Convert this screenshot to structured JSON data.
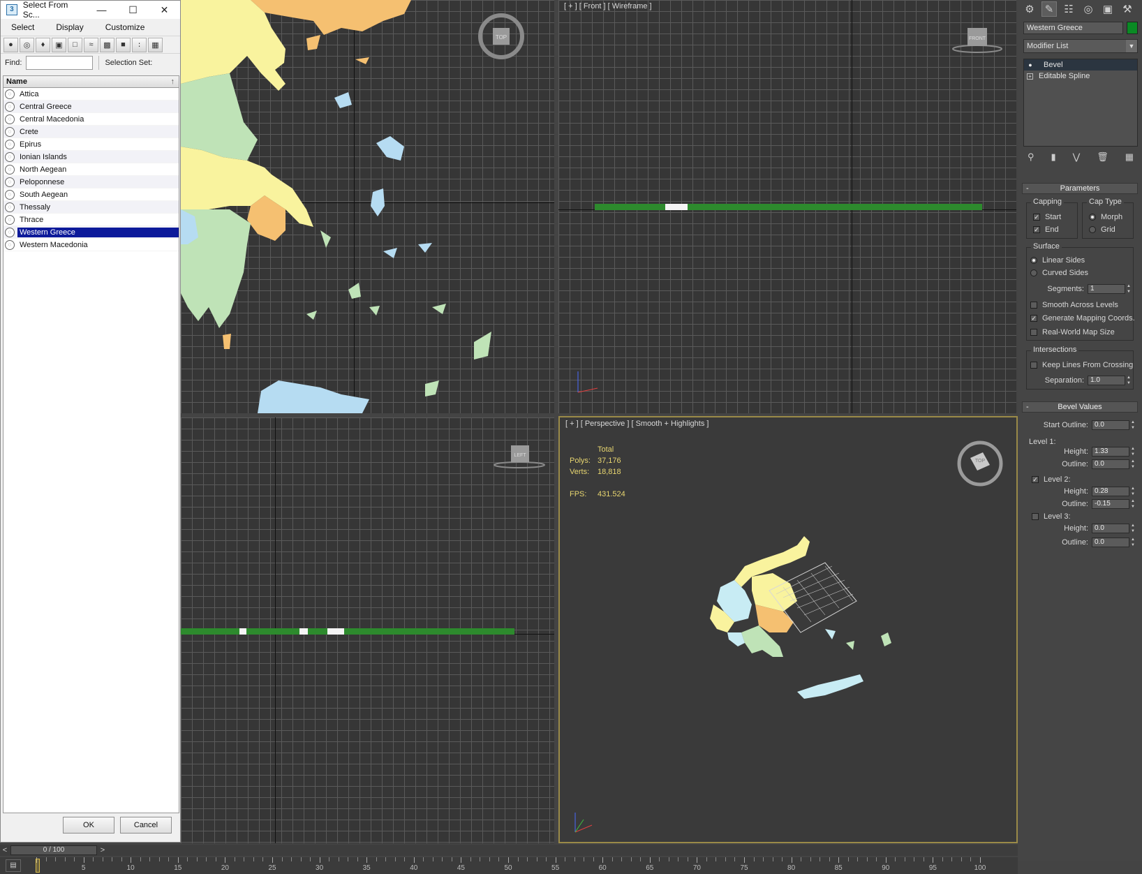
{
  "dialog": {
    "title": "Select From Sc...",
    "menu": [
      "Select",
      "Display",
      "Customize"
    ],
    "find_label": "Find:",
    "find_value": "",
    "selection_set_label": "Selection Set:",
    "column_header": "Name",
    "items": [
      {
        "label": "Attica",
        "selected": false
      },
      {
        "label": "Central Greece",
        "selected": false
      },
      {
        "label": "Central Macedonia",
        "selected": false
      },
      {
        "label": "Crete",
        "selected": false
      },
      {
        "label": "Epirus",
        "selected": false
      },
      {
        "label": "Ionian Islands",
        "selected": false
      },
      {
        "label": "North Aegean",
        "selected": false
      },
      {
        "label": "Peloponnese",
        "selected": false
      },
      {
        "label": "South Aegean",
        "selected": false
      },
      {
        "label": "Thessaly",
        "selected": false
      },
      {
        "label": "Thrace",
        "selected": false
      },
      {
        "label": "Western Greece",
        "selected": true
      },
      {
        "label": "Western Macedonia",
        "selected": false
      }
    ],
    "ok_label": "OK",
    "cancel_label": "Cancel"
  },
  "viewports": {
    "top_left_cube": "TOP",
    "front_label": "[ + ] [ Front ] [ Wireframe ]",
    "front_cube": "FRONT",
    "left_cube": "LEFT",
    "persp_label": "[ + ] [ Perspective ] [ Smooth + Highlights ]",
    "persp_cube": "TOP",
    "stats": {
      "total_label": "Total",
      "polys_label": "Polys:",
      "polys_value": "37,176",
      "verts_label": "Verts:",
      "verts_value": "18,818",
      "fps_label": "FPS:",
      "fps_value": "431.524"
    }
  },
  "command_panel": {
    "object_name": "Western Greece",
    "object_color": "#0a8a24",
    "modifier_list": "Modifier List",
    "stack": [
      "Bevel",
      "Editable Spline"
    ],
    "parameters": {
      "title": "Parameters",
      "capping_label": "Capping",
      "start_label": "Start",
      "end_label": "End",
      "cap_type_label": "Cap Type",
      "morph_label": "Morph",
      "grid_label": "Grid",
      "surface_label": "Surface",
      "linear_sides_label": "Linear Sides",
      "curved_sides_label": "Curved Sides",
      "segments_label": "Segments:",
      "segments_value": "1",
      "smooth_levels_label": "Smooth Across Levels",
      "gen_mapping_label": "Generate Mapping Coords.",
      "real_world_label": "Real-World Map Size",
      "intersections_label": "Intersections",
      "keep_lines_label": "Keep Lines From Crossing",
      "separation_label": "Separation:",
      "separation_value": "1.0"
    },
    "bevel_values": {
      "title": "Bevel Values",
      "start_outline_label": "Start Outline:",
      "start_outline_value": "0.0",
      "level1_label": "Level 1:",
      "level1_height_label": "Height:",
      "level1_height_value": "1.33",
      "level1_outline_label": "Outline:",
      "level1_outline_value": "0.0",
      "level2_label": "Level 2:",
      "level2_height_label": "Height:",
      "level2_height_value": "0.28",
      "level2_outline_label": "Outline:",
      "level2_outline_value": "-0.15",
      "level3_label": "Level 3:",
      "level3_height_label": "Height:",
      "level3_height_value": "0.0",
      "level3_outline_label": "Outline:",
      "level3_outline_value": "0.0"
    }
  },
  "timeline": {
    "frame_display": "0 / 100",
    "prev": "<",
    "next": ">",
    "ticks": [
      "5",
      "10",
      "15",
      "20",
      "25",
      "30",
      "35",
      "40",
      "45",
      "50",
      "55",
      "60",
      "65",
      "70",
      "75",
      "80",
      "85",
      "90",
      "95",
      "100"
    ]
  }
}
